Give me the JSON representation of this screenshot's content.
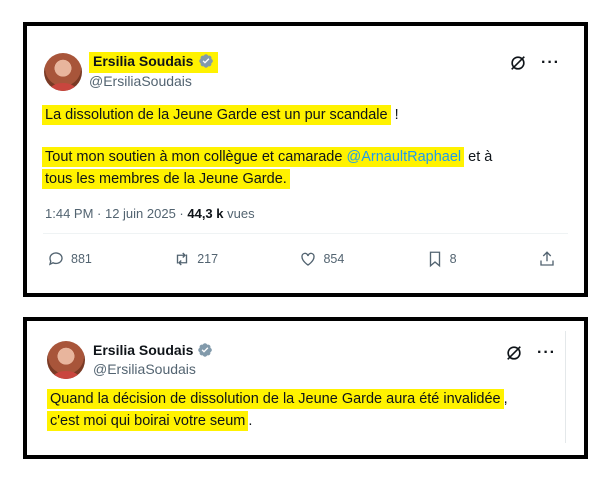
{
  "tweet1": {
    "author_name": "Ersilia Soudais",
    "handle": "@ErsiliaSoudais",
    "line1": "La dissolution de la Jeune Garde est un pur scandale",
    "line1_punct": " !",
    "line2_pre": "Tout mon soutien à mon collègue et camarade ",
    "line2_mention": "@ArnaultRaphael",
    "line2_post": " et à",
    "line3": "tous les membres de la Jeune Garde.",
    "time": "1:44 PM · 12 juin 2025 · ",
    "views_count": "44,3 k",
    "views_label": " vues",
    "replies": "881",
    "reposts": "217",
    "likes": "854",
    "bookmarks": "8"
  },
  "tweet2": {
    "author_name": "Ersilia Soudais",
    "handle": "@ErsiliaSoudais",
    "line1": "Quand la décision de dissolution de la Jeune Garde aura été invalidée",
    "line1_punct": ",",
    "line2": "c'est moi qui boirai votre seum",
    "line2_punct": "."
  },
  "icons": {
    "verified": "verified-badge-icon",
    "grok": "grok-icon",
    "more": "more-icon",
    "reply": "reply-icon",
    "repost": "repost-icon",
    "like": "heart-icon",
    "bookmark": "bookmark-icon",
    "share": "share-icon"
  },
  "colors": {
    "highlight": "#fff200",
    "mention": "#1d9bf0",
    "verified": "#829aab",
    "secondary_text": "#536471"
  },
  "glyphs": {
    "more": "···"
  }
}
